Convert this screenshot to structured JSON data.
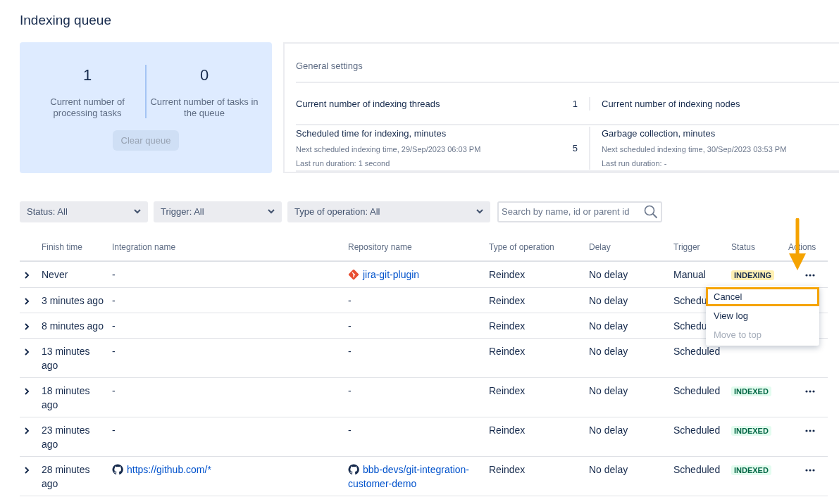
{
  "page_title": "Indexing queue",
  "queue_stats": [
    {
      "value": "1",
      "label": "Current number of processing tasks"
    },
    {
      "value": "0",
      "label": "Current number of tasks in the queue"
    }
  ],
  "clear_button": {
    "label": "Clear queue",
    "disabled": true
  },
  "general_settings": {
    "title": "General settings",
    "rows": [
      {
        "left": {
          "title": "Current number of indexing threads",
          "value": "1"
        },
        "right": {
          "title": "Current number of indexing nodes"
        }
      },
      {
        "left": {
          "title": "Scheduled time for indexing, minutes",
          "notes": [
            "Next scheduled indexing time, 29/Sep/2023 06:03 PM",
            "Last run duration: 1 second"
          ],
          "value": "5"
        },
        "right": {
          "title": "Garbage collection, minutes",
          "notes": [
            "Next scheduled indexing time, 30/Sep/2023 03:53 PM",
            "Last run duration: -"
          ]
        }
      }
    ]
  },
  "filters": [
    {
      "label": "Status: All"
    },
    {
      "label": "Trigger: All"
    },
    {
      "label": "Type of operation: All"
    }
  ],
  "search": {
    "placeholder": "Search by name, id or parent id"
  },
  "table": {
    "columns": [
      "Finish time",
      "Integration name",
      "Repository name",
      "Type of operation",
      "Delay",
      "Trigger",
      "Status",
      "Actions"
    ],
    "rows": [
      {
        "finish": "Never",
        "integration": {
          "text": "-"
        },
        "repository": {
          "text": "jira-git-plugin",
          "kind": "git"
        },
        "operation": "Reindex",
        "delay": "No delay",
        "trigger": "Manual",
        "status": {
          "text": "INDEXING",
          "kind": "indexing"
        },
        "actions": true
      },
      {
        "finish": "3 minutes ago",
        "integration": {
          "text": "-"
        },
        "repository": {
          "text": "-"
        },
        "operation": "Reindex",
        "delay": "No delay",
        "trigger": "Schedu",
        "actions": false
      },
      {
        "finish": "8 minutes ago",
        "integration": {
          "text": "-"
        },
        "repository": {
          "text": "-"
        },
        "operation": "Reindex",
        "delay": "No delay",
        "trigger": "Schedu",
        "actions": false
      },
      {
        "finish": "13 minutes ago",
        "integration": {
          "text": "-"
        },
        "repository": {
          "text": "-"
        },
        "operation": "Reindex",
        "delay": "No delay",
        "trigger": "Scheduled",
        "actions": false
      },
      {
        "finish": "18 minutes ago",
        "integration": {
          "text": "-"
        },
        "repository": {
          "text": "-"
        },
        "operation": "Reindex",
        "delay": "No delay",
        "trigger": "Scheduled",
        "status": {
          "text": "INDEXED",
          "kind": "indexed"
        },
        "actions": true
      },
      {
        "finish": "23 minutes ago",
        "integration": {
          "text": "-"
        },
        "repository": {
          "text": "-"
        },
        "operation": "Reindex",
        "delay": "No delay",
        "trigger": "Scheduled",
        "status": {
          "text": "INDEXED",
          "kind": "indexed"
        },
        "actions": true
      },
      {
        "finish": "28 minutes ago",
        "integration": {
          "text": "https://github.com/*",
          "kind": "github"
        },
        "repository": {
          "text": "bbb-devs/git-integration-customer-demo",
          "kind": "github"
        },
        "operation": "Reindex",
        "delay": "No delay",
        "trigger": "Scheduled",
        "status": {
          "text": "INDEXED",
          "kind": "indexed"
        },
        "actions": true
      }
    ]
  },
  "actions_menu": {
    "items": [
      {
        "label": "Cancel",
        "highlighted": true,
        "disabled": false
      },
      {
        "label": "View log",
        "highlighted": false,
        "disabled": false
      },
      {
        "label": "Move to top",
        "highlighted": false,
        "disabled": true
      }
    ]
  },
  "callout_arrow": true
}
